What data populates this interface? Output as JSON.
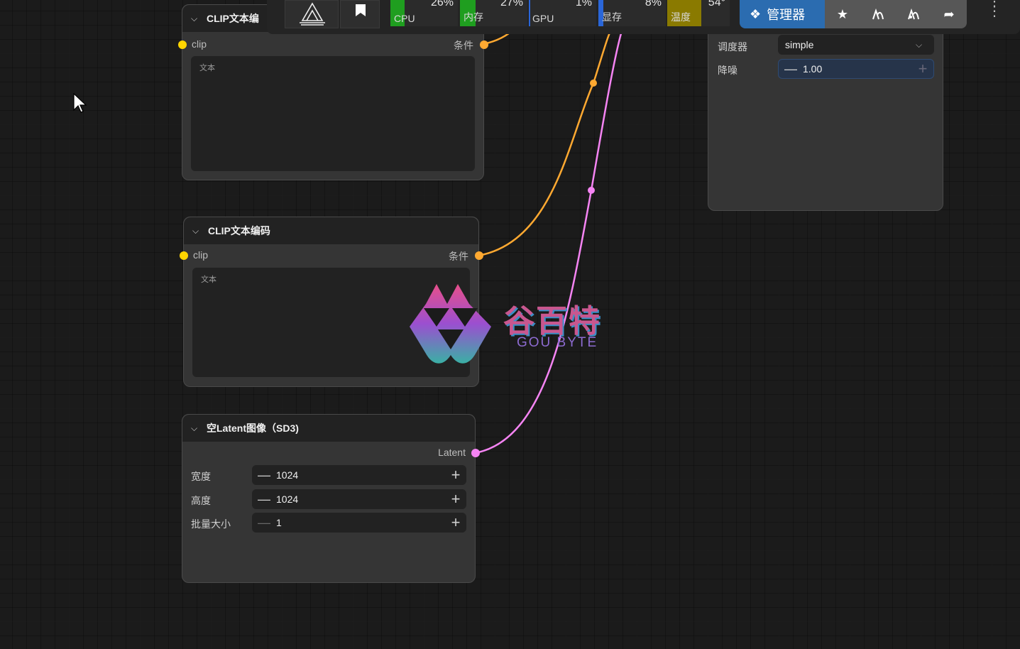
{
  "toolbar": {
    "monitors": [
      {
        "label": "CPU",
        "value": "26%",
        "percent": 26,
        "color": "#1f9e1f"
      },
      {
        "label": "内存",
        "value": "27%",
        "percent": 27,
        "color": "#1f9e1f"
      },
      {
        "label": "GPU",
        "value": "1%",
        "percent": 1,
        "color": "#2a66d9"
      },
      {
        "label": "显存",
        "value": "8%",
        "percent": 8,
        "color": "#2a66d9"
      },
      {
        "label": "温度",
        "value": "54°",
        "percent": 54,
        "color": "#8a7a00"
      }
    ],
    "manager_label": "管理器",
    "icons": [
      "comfy-logo-icon",
      "bookmark-icon",
      "puzzle-icon",
      "star-icon",
      "graph-icon",
      "graph-alt-icon",
      "share-icon",
      "kebab-menu-icon"
    ]
  },
  "nodes": {
    "clip1": {
      "title": "CLIP文本编",
      "input": "clip",
      "output": "条件",
      "placeholder": "文本"
    },
    "clip2": {
      "title": "CLIP文本编码",
      "input": "clip",
      "output": "条件",
      "placeholder": "文本"
    },
    "latent": {
      "title": "空Latent图像（SD3)",
      "output": "Latent",
      "widgets": [
        {
          "label": "宽度",
          "value": "1024"
        },
        {
          "label": "高度",
          "value": "1024"
        },
        {
          "label": "批量大小",
          "value": "1"
        }
      ]
    },
    "sampler": {
      "widgets": [
        {
          "label": "调度器",
          "value": "simple"
        },
        {
          "label": "降噪",
          "value": "1.00"
        }
      ]
    }
  },
  "watermark": {
    "brand_cn": "谷百特",
    "brand_en": "GOU BYTE"
  }
}
